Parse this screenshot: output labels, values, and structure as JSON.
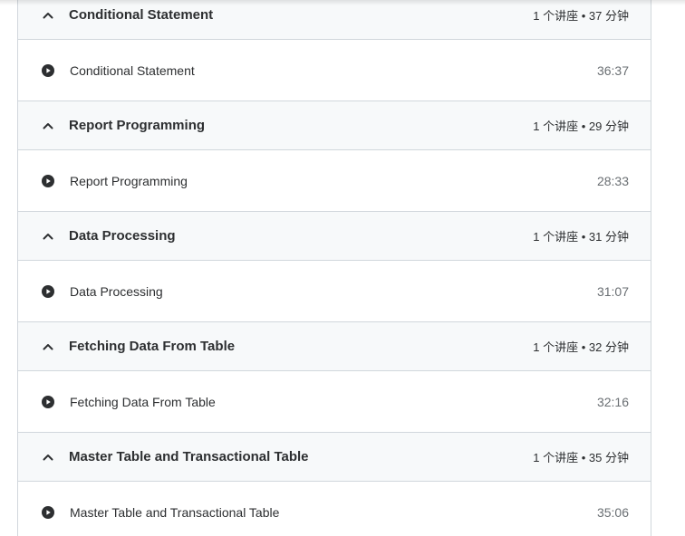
{
  "sections": [
    {
      "title": "Conditional Statement",
      "meta": "1 个讲座 • 37 分钟",
      "expanded_icon": "chevron-up-icon",
      "lectures": [
        {
          "title": "Conditional Statement",
          "duration": "36:37",
          "icon": "play-circle-icon"
        }
      ]
    },
    {
      "title": "Report Programming",
      "meta": "1 个讲座 • 29 分钟",
      "expanded_icon": "chevron-up-icon",
      "lectures": [
        {
          "title": "Report Programming",
          "duration": "28:33",
          "icon": "play-circle-icon"
        }
      ]
    },
    {
      "title": "Data Processing",
      "meta": "1 个讲座 • 31 分钟",
      "expanded_icon": "chevron-up-icon",
      "lectures": [
        {
          "title": "Data Processing",
          "duration": "31:07",
          "icon": "play-circle-icon"
        }
      ]
    },
    {
      "title": "Fetching Data From Table",
      "meta": "1 个讲座 • 32 分钟",
      "expanded_icon": "chevron-up-icon",
      "lectures": [
        {
          "title": "Fetching Data From Table",
          "duration": "32:16",
          "icon": "play-circle-icon"
        }
      ]
    },
    {
      "title": "Master Table and Transactional Table",
      "meta": "1 个讲座 • 35 分钟",
      "expanded_icon": "chevron-up-icon",
      "lectures": [
        {
          "title": "Master Table and Transactional Table",
          "duration": "35:06",
          "icon": "play-circle-icon"
        }
      ]
    }
  ],
  "colors": {
    "text": "#2d2f31",
    "muted": "#6a6f73",
    "header_bg": "#f7f9fa",
    "border": "#d1d7dc"
  }
}
